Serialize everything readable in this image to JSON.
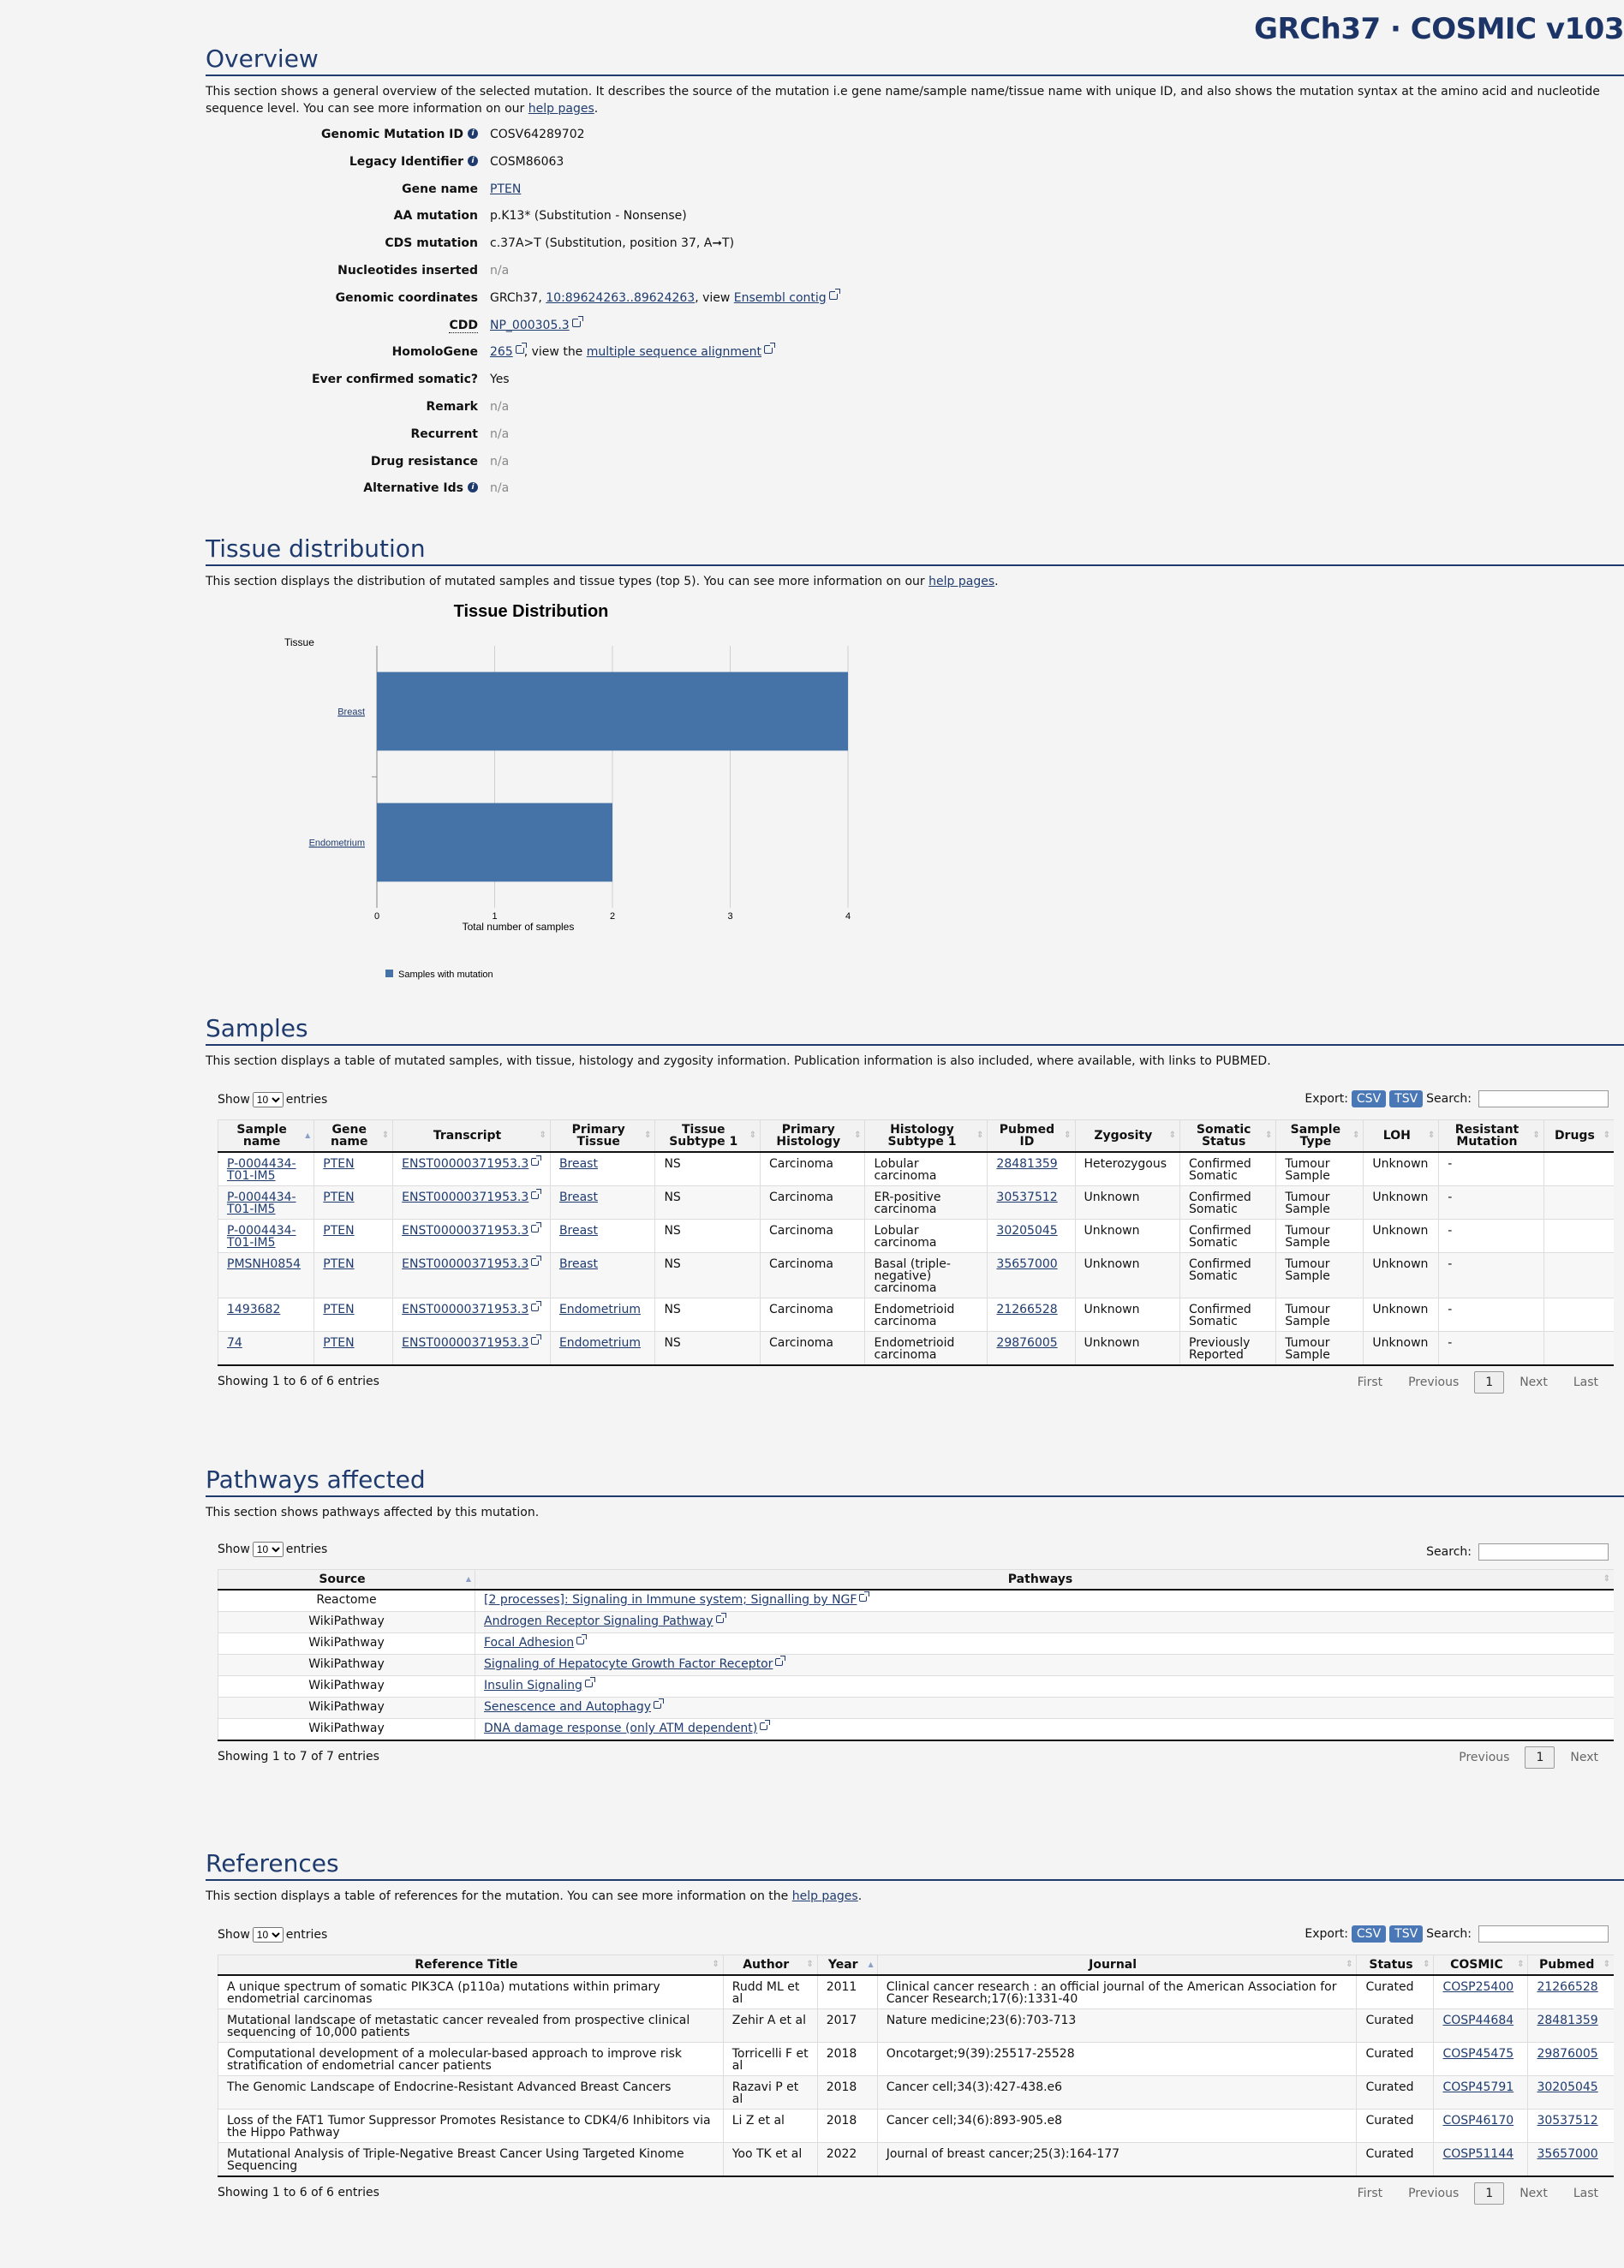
{
  "brand": "GRCh37 · COSMIC v103",
  "overview": {
    "title": "Overview",
    "desc": "This section shows a general overview of the selected mutation. It describes the source of the mutation i.e gene name/sample name/tissue name with unique ID, and also shows the mutation syntax at the amino acid and nucleotide sequence level. You can see more information on our ",
    "help": "help pages",
    "fields": {
      "gmid_k": "Genomic Mutation ID",
      "gmid_v": "COSV64289702",
      "legacy_k": "Legacy Identifier",
      "legacy_v": "COSM86063",
      "gene_k": "Gene name",
      "gene_v": "PTEN",
      "aa_k": "AA mutation",
      "aa_v": "p.K13* (Substitution - Nonsense)",
      "cds_k": "CDS mutation",
      "cds_v": "c.37A>T (Substitution, position 37, A➞T)",
      "nuc_k": "Nucleotides inserted",
      "nuc_v": "n/a",
      "coord_k": "Genomic coordinates",
      "coord_pre": "GRCh37, ",
      "coord_link": "10:89624263..89624263",
      "coord_mid": ", view ",
      "coord_ens": "Ensembl contig",
      "cdd_k": "CDD",
      "cdd_v": "NP_000305.3",
      "homo_k": "HomoloGene",
      "homo_link": "265",
      "homo_mid": ", view the ",
      "homo_msa": "multiple sequence alignment",
      "ever_k": "Ever confirmed somatic?",
      "ever_v": "Yes",
      "remark_k": "Remark",
      "remark_v": "n/a",
      "recur_k": "Recurrent",
      "recur_v": "n/a",
      "drug_k": "Drug resistance",
      "drug_v": "n/a",
      "alt_k": "Alternative Ids",
      "alt_v": "n/a"
    }
  },
  "tissue": {
    "title": "Tissue distribution",
    "desc": "This section displays the distribution of mutated samples and tissue types (top 5). You can see more information on our ",
    "help": "help pages"
  },
  "chart_data": {
    "type": "bar",
    "orientation": "horizontal",
    "title": "Tissue Distribution",
    "ylabel": "Tissue",
    "xlabel": "Total number of samples",
    "categories": [
      "Breast",
      "Endometrium"
    ],
    "series": [
      {
        "name": "Samples with mutation",
        "values": [
          4,
          2
        ],
        "color": "#4572a7"
      }
    ],
    "xlim": [
      0,
      4
    ],
    "xticks": [
      "0",
      "1",
      "2",
      "3",
      "4"
    ],
    "grid": true,
    "legend": "bottom"
  },
  "samples": {
    "title": "Samples",
    "desc": "This section displays a table of mutated samples, with tissue, histology and zygosity information. Publication information is also included, where available, with links to PUBMED.",
    "show": "Show",
    "entries": "entries",
    "page_size": "10",
    "export": "Export:",
    "csv": "CSV",
    "tsv": "TSV",
    "search": "Search:",
    "headers": [
      "Sample name",
      "Gene name",
      "Transcript",
      "Primary Tissue",
      "Tissue Subtype 1",
      "Primary Histology",
      "Histology Subtype 1",
      "Pubmed ID",
      "Zygosity",
      "Somatic Status",
      "Sample Type",
      "LOH",
      "Resistant Mutation",
      "Drugs"
    ],
    "rows": [
      [
        "P-0004434-T01-IM5",
        "PTEN",
        "ENST00000371953.3",
        "Breast",
        "NS",
        "Carcinoma",
        "Lobular carcinoma",
        "28481359",
        "Heterozygous",
        "Confirmed Somatic",
        "Tumour Sample",
        "Unknown",
        "-",
        ""
      ],
      [
        "P-0004434-T01-IM5",
        "PTEN",
        "ENST00000371953.3",
        "Breast",
        "NS",
        "Carcinoma",
        "ER-positive carcinoma",
        "30537512",
        "Unknown",
        "Confirmed Somatic",
        "Tumour Sample",
        "Unknown",
        "-",
        ""
      ],
      [
        "P-0004434-T01-IM5",
        "PTEN",
        "ENST00000371953.3",
        "Breast",
        "NS",
        "Carcinoma",
        "Lobular carcinoma",
        "30205045",
        "Unknown",
        "Confirmed Somatic",
        "Tumour Sample",
        "Unknown",
        "-",
        ""
      ],
      [
        "PMSNH0854",
        "PTEN",
        "ENST00000371953.3",
        "Breast",
        "NS",
        "Carcinoma",
        "Basal (triple-negative) carcinoma",
        "35657000",
        "Unknown",
        "Confirmed Somatic",
        "Tumour Sample",
        "Unknown",
        "-",
        ""
      ],
      [
        "1493682",
        "PTEN",
        "ENST00000371953.3",
        "Endometrium",
        "NS",
        "Carcinoma",
        "Endometrioid carcinoma",
        "21266528",
        "Unknown",
        "Confirmed Somatic",
        "Tumour Sample",
        "Unknown",
        "-",
        ""
      ],
      [
        "74",
        "PTEN",
        "ENST00000371953.3",
        "Endometrium",
        "NS",
        "Carcinoma",
        "Endometrioid carcinoma",
        "29876005",
        "Unknown",
        "Previously Reported",
        "Tumour Sample",
        "Unknown",
        "-",
        ""
      ]
    ],
    "info": "Showing 1 to 6 of 6 entries",
    "pager": {
      "first": "First",
      "prev": "Previous",
      "page": "1",
      "next": "Next",
      "last": "Last"
    }
  },
  "pathways": {
    "title": "Pathways affected",
    "desc": "This section shows pathways affected by this mutation.",
    "show": "Show",
    "entries": "entries",
    "page_size": "10",
    "search": "Search:",
    "headers": [
      "Source",
      "Pathways"
    ],
    "rows": [
      [
        "Reactome",
        "[2 processes]: Signaling in Immune system; Signalling by NGF"
      ],
      [
        "WikiPathway",
        "Androgen Receptor Signaling Pathway"
      ],
      [
        "WikiPathway",
        "Focal Adhesion"
      ],
      [
        "WikiPathway",
        "Signaling of Hepatocyte Growth Factor Receptor"
      ],
      [
        "WikiPathway",
        "Insulin Signaling"
      ],
      [
        "WikiPathway",
        "Senescence and Autophagy"
      ],
      [
        "WikiPathway",
        "DNA damage response (only ATM dependent)"
      ]
    ],
    "info": "Showing 1 to 7 of 7 entries",
    "pager": {
      "prev": "Previous",
      "page": "1",
      "next": "Next"
    }
  },
  "references": {
    "title": "References",
    "desc": "This section displays a table of references for the mutation. You can see more information on the ",
    "help": "help pages",
    "show": "Show",
    "entries": "entries",
    "page_size": "10",
    "export": "Export:",
    "csv": "CSV",
    "tsv": "TSV",
    "search": "Search:",
    "headers": [
      "Reference Title",
      "Author",
      "Year",
      "Journal",
      "Status",
      "COSMIC",
      "Pubmed"
    ],
    "rows": [
      [
        "A unique spectrum of somatic PIK3CA (p110a) mutations within primary endometrial carcinomas",
        "Rudd ML et al",
        "2011",
        "Clinical cancer research : an official journal of the American Association for Cancer Research;17(6):1331-40",
        "Curated",
        "COSP25400",
        "21266528"
      ],
      [
        "Mutational landscape of metastatic cancer revealed from prospective clinical sequencing of 10,000 patients",
        "Zehir A et al",
        "2017",
        "Nature medicine;23(6):703-713",
        "Curated",
        "COSP44684",
        "28481359"
      ],
      [
        "Computational development of a molecular-based approach to improve risk stratification of endometrial cancer patients",
        "Torricelli F et al",
        "2018",
        "Oncotarget;9(39):25517-25528",
        "Curated",
        "COSP45475",
        "29876005"
      ],
      [
        "The Genomic Landscape of Endocrine-Resistant Advanced Breast Cancers",
        "Razavi P et al",
        "2018",
        "Cancer cell;34(3):427-438.e6",
        "Curated",
        "COSP45791",
        "30205045"
      ],
      [
        "Loss of the FAT1 Tumor Suppressor Promotes Resistance to CDK4/6 Inhibitors via the Hippo Pathway",
        "Li Z et al",
        "2018",
        "Cancer cell;34(6):893-905.e8",
        "Curated",
        "COSP46170",
        "30537512"
      ],
      [
        "Mutational Analysis of Triple-Negative Breast Cancer Using Targeted Kinome Sequencing",
        "Yoo TK et al",
        "2022",
        "Journal of breast cancer;25(3):164-177",
        "Curated",
        "COSP51144",
        "35657000"
      ]
    ],
    "info": "Showing 1 to 6 of 6 entries",
    "pager": {
      "first": "First",
      "prev": "Previous",
      "page": "1",
      "next": "Next",
      "last": "Last"
    }
  }
}
